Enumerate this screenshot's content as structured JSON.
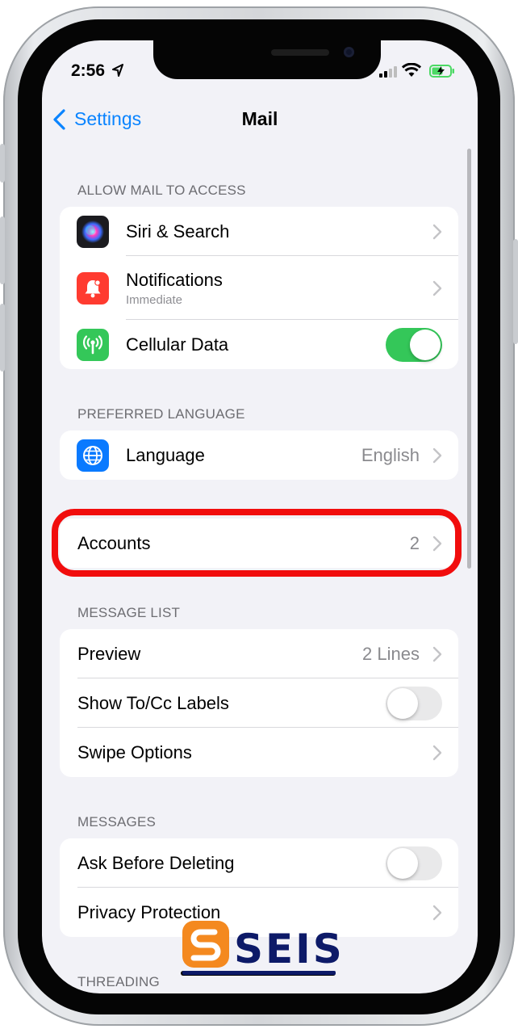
{
  "status_bar": {
    "time": "2:56"
  },
  "nav": {
    "back_label": "Settings",
    "title": "Mail"
  },
  "sections": {
    "allow_access": {
      "header": "ALLOW MAIL TO ACCESS",
      "siri": {
        "label": "Siri & Search",
        "icon": "siri-icon"
      },
      "notifications": {
        "label": "Notifications",
        "sublabel": "Immediate",
        "icon": "bell-icon"
      },
      "cellular": {
        "label": "Cellular Data",
        "icon": "antenna-icon",
        "enabled": true
      }
    },
    "preferred_language": {
      "header": "PREFERRED LANGUAGE",
      "language": {
        "label": "Language",
        "value": "English",
        "icon": "globe-icon"
      }
    },
    "accounts": {
      "label": "Accounts",
      "value": "2"
    },
    "message_list": {
      "header": "MESSAGE LIST",
      "preview": {
        "label": "Preview",
        "value": "2 Lines"
      },
      "show_to_cc": {
        "label": "Show To/Cc Labels",
        "enabled": false
      },
      "swipe_options": {
        "label": "Swipe Options"
      }
    },
    "messages": {
      "header": "MESSAGES",
      "ask_before_deleting": {
        "label": "Ask Before Deleting",
        "enabled": false
      },
      "privacy_protection": {
        "label": "Privacy Protection"
      }
    },
    "threading": {
      "header": "THREADING"
    }
  },
  "watermark": {
    "text": "SEIS"
  },
  "colors": {
    "accent": "#0a84ff",
    "toggle_on": "#34c759",
    "highlight": "#f10d0d",
    "background": "#f2f2f7"
  }
}
